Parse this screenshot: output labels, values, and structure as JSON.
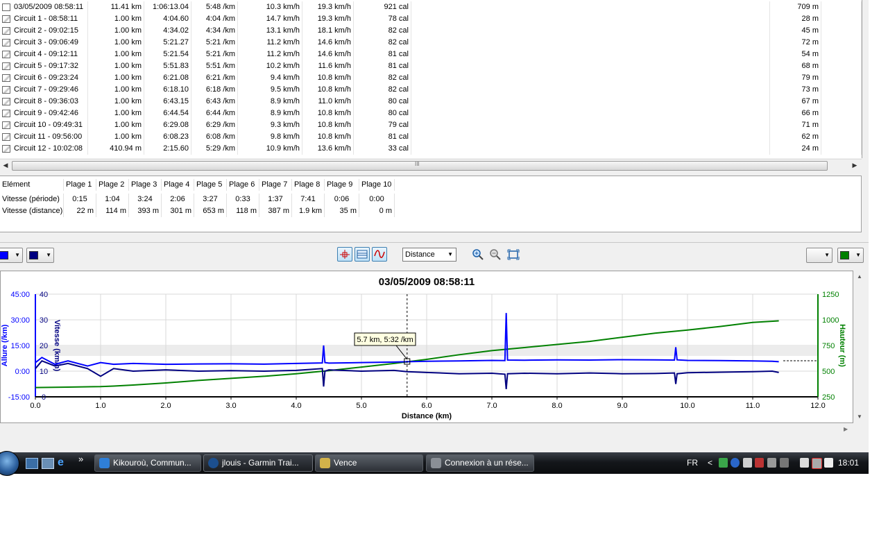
{
  "laps": [
    {
      "name": "03/05/2009 08:58:11",
      "distance": "11.41 km",
      "time": "1:06:13.04",
      "pace": "5:48 /km",
      "avg_speed": "10.3 km/h",
      "max_speed": "19.3 km/h",
      "calories": "921 cal",
      "ascent": "709 m"
    },
    {
      "name": "Circuit 1 - 08:58:11",
      "distance": "1.00 km",
      "time": "4:04.60",
      "pace": "4:04 /km",
      "avg_speed": "14.7 km/h",
      "max_speed": "19.3 km/h",
      "calories": "78 cal",
      "ascent": "28 m"
    },
    {
      "name": "Circuit 2 - 09:02:15",
      "distance": "1.00 km",
      "time": "4:34.02",
      "pace": "4:34 /km",
      "avg_speed": "13.1 km/h",
      "max_speed": "18.1 km/h",
      "calories": "82 cal",
      "ascent": "45 m"
    },
    {
      "name": "Circuit 3 - 09:06:49",
      "distance": "1.00 km",
      "time": "5:21.27",
      "pace": "5:21 /km",
      "avg_speed": "11.2 km/h",
      "max_speed": "14.6 km/h",
      "calories": "82 cal",
      "ascent": "72 m"
    },
    {
      "name": "Circuit 4 - 09:12:11",
      "distance": "1.00 km",
      "time": "5:21.54",
      "pace": "5:21 /km",
      "avg_speed": "11.2 km/h",
      "max_speed": "14.6 km/h",
      "calories": "81 cal",
      "ascent": "54 m"
    },
    {
      "name": "Circuit 5 - 09:17:32",
      "distance": "1.00 km",
      "time": "5:51.83",
      "pace": "5:51 /km",
      "avg_speed": "10.2 km/h",
      "max_speed": "11.6 km/h",
      "calories": "81 cal",
      "ascent": "68 m"
    },
    {
      "name": "Circuit 6 - 09:23:24",
      "distance": "1.00 km",
      "time": "6:21.08",
      "pace": "6:21 /km",
      "avg_speed": "9.4 km/h",
      "max_speed": "10.8 km/h",
      "calories": "82 cal",
      "ascent": "79 m"
    },
    {
      "name": "Circuit 7 - 09:29:46",
      "distance": "1.00 km",
      "time": "6:18.10",
      "pace": "6:18 /km",
      "avg_speed": "9.5 km/h",
      "max_speed": "10.8 km/h",
      "calories": "82 cal",
      "ascent": "73 m"
    },
    {
      "name": "Circuit 8 - 09:36:03",
      "distance": "1.00 km",
      "time": "6:43.15",
      "pace": "6:43 /km",
      "avg_speed": "8.9 km/h",
      "max_speed": "11.0 km/h",
      "calories": "80 cal",
      "ascent": "67 m"
    },
    {
      "name": "Circuit 9 - 09:42:46",
      "distance": "1.00 km",
      "time": "6:44.54",
      "pace": "6:44 /km",
      "avg_speed": "8.9 km/h",
      "max_speed": "10.8 km/h",
      "calories": "80 cal",
      "ascent": "66 m"
    },
    {
      "name": "Circuit 10 - 09:49:31",
      "distance": "1.00 km",
      "time": "6:29.08",
      "pace": "6:29 /km",
      "avg_speed": "9.3 km/h",
      "max_speed": "10.8 km/h",
      "calories": "79 cal",
      "ascent": "71 m"
    },
    {
      "name": "Circuit 11 - 09:56:00",
      "distance": "1.00 km",
      "time": "6:08.23",
      "pace": "6:08 /km",
      "avg_speed": "9.8 km/h",
      "max_speed": "10.8 km/h",
      "calories": "81 cal",
      "ascent": "62 m"
    },
    {
      "name": "Circuit 12 - 10:02:08",
      "distance": "410.94 m",
      "time": "2:15.60",
      "pace": "5:29 /km",
      "avg_speed": "10.9 km/h",
      "max_speed": "13.6 km/h",
      "calories": "33 cal",
      "ascent": "24 m"
    }
  ],
  "scroll_grip": "III",
  "zones": {
    "header": [
      "Elément",
      "Plage 1",
      "Plage 2",
      "Plage 3",
      "Plage 4",
      "Plage 5",
      "Plage 6",
      "Plage 7",
      "Plage 8",
      "Plage 9",
      "Plage 10"
    ],
    "rows": [
      {
        "label": "Vitesse (période)",
        "values": [
          "0:15",
          "1:04",
          "3:24",
          "2:06",
          "3:27",
          "0:33",
          "1:37",
          "7:41",
          "0:06",
          "0:00"
        ]
      },
      {
        "label": "Vitesse (distance)",
        "values": [
          "22 m",
          "114 m",
          "393 m",
          "301 m",
          "653 m",
          "118 m",
          "387 m",
          "1.9 km",
          "35 m",
          "0 m"
        ]
      }
    ]
  },
  "toolbar": {
    "distance_select": "Distance",
    "left_color_1": "#0000ff",
    "left_color_2": "#000080",
    "right_color": "#008000"
  },
  "chart_data": {
    "type": "line",
    "title": "03/05/2009 08:58:11",
    "xlabel": "Distance (km)",
    "xlim": [
      0,
      12
    ],
    "x_ticks": [
      "0.0",
      "1.0",
      "2.0",
      "3.0",
      "4.0",
      "5.0",
      "6.0",
      "7.0",
      "8.0",
      "9.0",
      "10.0",
      "11.0",
      "12.0"
    ],
    "y_left_pace": {
      "label": "Allure (/km)",
      "ticks": [
        "45:00",
        "30:00",
        "15:00",
        "0:00",
        "-15:00"
      ],
      "color": "#0000ff"
    },
    "y_left_speed": {
      "label": "Vitesse (km/h)",
      "ticks": [
        "40",
        "30",
        "20",
        "10",
        "0"
      ],
      "color": "#000080"
    },
    "y_right": {
      "label": "Hauteur (m)",
      "ticks": [
        "1250",
        "1000",
        "750",
        "500",
        "250"
      ],
      "color": "#008000",
      "ylim": [
        250,
        1250
      ]
    },
    "tooltip": "5.7 km, 5:32 /km",
    "cursor_x": 5.7,
    "series": [
      {
        "name": "Hauteur (m)",
        "color": "#008000",
        "x": [
          0,
          0.5,
          1,
          1.2,
          1.5,
          2,
          2.5,
          3,
          3.5,
          4,
          4.5,
          5,
          5.5,
          6,
          6.5,
          7,
          7.5,
          8,
          8.5,
          9,
          9.5,
          10,
          10.5,
          11,
          11.4
        ],
        "values": [
          340,
          345,
          350,
          355,
          365,
          385,
          410,
          430,
          450,
          475,
          505,
          540,
          575,
          615,
          660,
          700,
          730,
          760,
          790,
          830,
          870,
          900,
          935,
          975,
          990
        ]
      },
      {
        "name": "Vitesse (km/h)",
        "color": "#000080",
        "x": [
          0,
          0.1,
          0.3,
          0.5,
          0.8,
          1,
          1.2,
          1.5,
          2,
          2.5,
          3,
          3.5,
          4,
          4.4,
          4.42,
          4.44,
          4.5,
          5,
          5.5,
          5.7,
          6,
          6.5,
          7,
          7.2,
          7.22,
          7.24,
          7.5,
          8,
          8.5,
          9,
          9.5,
          9.8,
          9.82,
          9.84,
          10,
          10.5,
          11,
          11.3,
          11.4
        ],
        "values": [
          11,
          14,
          12,
          13,
          11,
          8,
          11,
          10,
          10.5,
          10,
          10.2,
          10,
          10.3,
          11,
          4,
          10,
          10.5,
          10,
          10.3,
          9.8,
          9.5,
          9,
          9.2,
          8.8,
          3,
          9,
          9.2,
          9,
          9.3,
          9,
          9.1,
          9.3,
          5,
          9,
          9.4,
          9.6,
          9.8,
          10,
          9.5
        ]
      },
      {
        "name": "Allure (/km)",
        "color": "#0000ff",
        "x": [
          0,
          0.1,
          0.3,
          0.5,
          0.8,
          1,
          1.2,
          1.5,
          2,
          2.5,
          3,
          3.5,
          4,
          4.4,
          4.42,
          4.44,
          4.5,
          5,
          5.5,
          5.7,
          6,
          6.5,
          7,
          7.2,
          7.22,
          7.24,
          7.5,
          8,
          8.5,
          9,
          9.5,
          9.8,
          9.82,
          9.84,
          10,
          10.5,
          11,
          11.3,
          11.4
        ],
        "values": [
          5,
          8,
          4,
          6,
          3,
          5,
          4,
          4.5,
          4,
          4.2,
          4.3,
          4.1,
          4.5,
          4.8,
          15,
          5,
          4.7,
          5,
          5.3,
          5.5,
          5.8,
          6,
          6.3,
          6.2,
          34,
          6.5,
          6.4,
          6.6,
          6.5,
          6.7,
          6.6,
          6.5,
          14,
          6.6,
          6.3,
          6.2,
          6,
          5.8,
          5.5
        ]
      }
    ]
  },
  "taskbar": {
    "tasks": [
      {
        "label": "Kikouroù, Commun..."
      },
      {
        "label": "jlouis - Garmin Trai..."
      },
      {
        "label": "Vence"
      },
      {
        "label": "Connexion à un rése..."
      }
    ],
    "lang": "FR",
    "clock": "18:01",
    "more": "»",
    "tray_arrow": "<"
  }
}
